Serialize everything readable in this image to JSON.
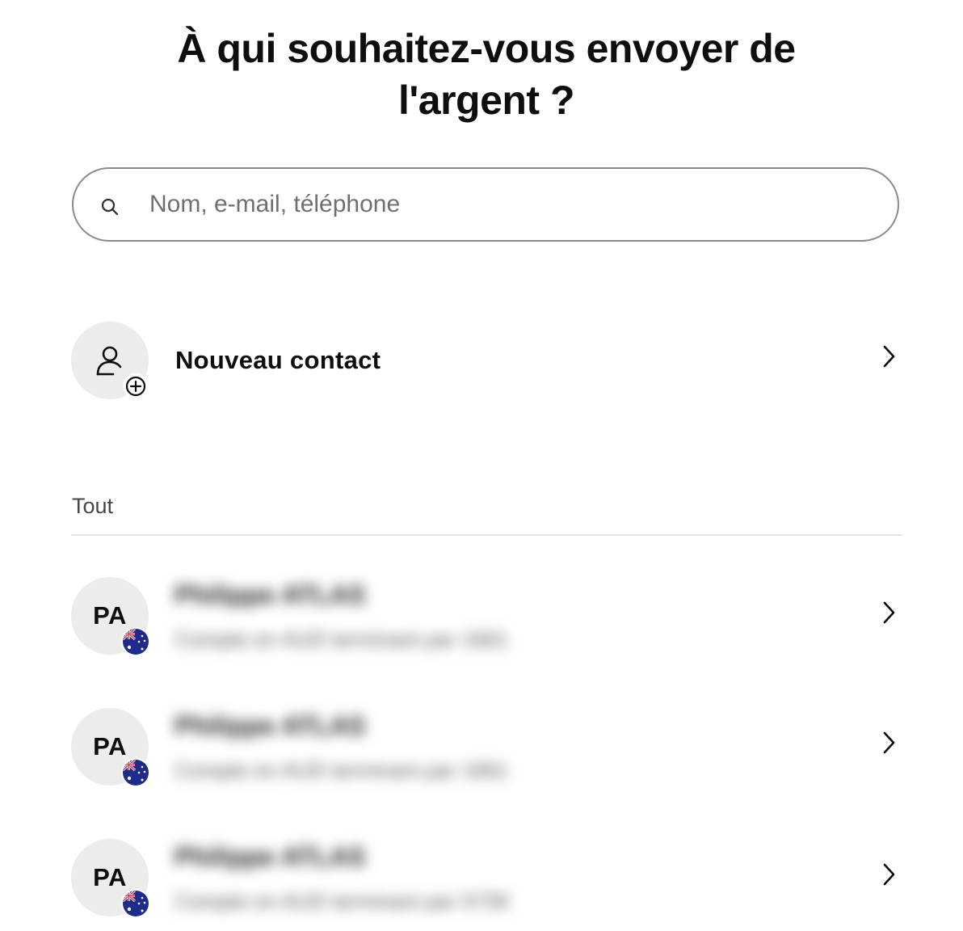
{
  "header": {
    "title": "À qui souhaitez-vous envoyer de l'argent ?"
  },
  "search": {
    "placeholder": "Nom, e-mail, téléphone",
    "value": "",
    "icon": "search-icon"
  },
  "new_contact": {
    "label": "Nouveau contact",
    "icon": "person-add-icon"
  },
  "contacts_section": {
    "label": "Tout",
    "items": [
      {
        "initials": "PA",
        "name": "Philippe ATLAS",
        "subtitle": "Compte en AUD terminant par 1661",
        "flag_icon": "australia-flag-icon"
      },
      {
        "initials": "PA",
        "name": "Philippe ATLAS",
        "subtitle": "Compte en AUD terminant par 1661",
        "flag_icon": "australia-flag-icon"
      },
      {
        "initials": "PA",
        "name": "Philippe ATLAS",
        "subtitle": "Compte en AUD terminant par 5739",
        "flag_icon": "australia-flag-icon"
      }
    ]
  },
  "colors": {
    "text": "#0e0f0c",
    "avatar_bg": "#ececea",
    "border": "#8a8a87",
    "divider": "#e2e2e0"
  }
}
